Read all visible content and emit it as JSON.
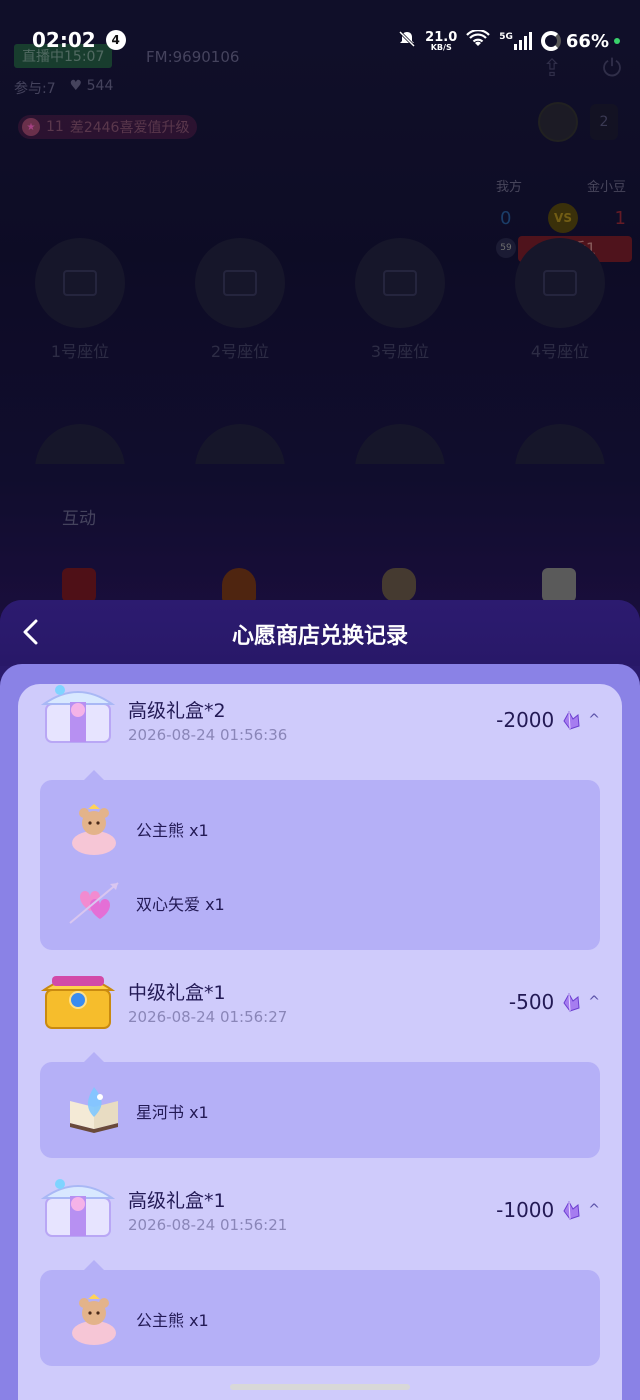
{
  "status_bar": {
    "time": "02:02",
    "notif_count": "4",
    "net_speed": "21.0",
    "net_unit": "KB/S",
    "network": "5G",
    "battery": "66%"
  },
  "room": {
    "live_status": "直播中15:07",
    "fm_id": "FM:9690106",
    "participants": "参与:7",
    "likes": "544",
    "level": "11",
    "level_hint": "差2446喜爱值升级",
    "online_count": "2",
    "pk": {
      "our_side": "我方",
      "their_side": "金小豆",
      "our_score": "0",
      "their_score": "1",
      "vs": "VS",
      "status": "落后1",
      "timer": "59"
    },
    "seats": [
      "1号座位",
      "2号座位",
      "3号座位",
      "4号座位"
    ],
    "interact_label": "互动"
  },
  "modal": {
    "title": "心愿商店兑换记录",
    "records": [
      {
        "title": "高级礼盒*2",
        "time": "2026-08-24 01:56:36",
        "cost": "-2000",
        "box": "silver",
        "items": [
          {
            "name": "公主熊 x1",
            "icon": "bear"
          },
          {
            "name": "双心矢爱 x1",
            "icon": "hearts"
          }
        ]
      },
      {
        "title": "中级礼盒*1",
        "time": "2026-08-24 01:56:27",
        "cost": "-500",
        "box": "gold",
        "items": [
          {
            "name": "星河书 x1",
            "icon": "book"
          }
        ]
      },
      {
        "title": "高级礼盒*1",
        "time": "2026-08-24 01:56:21",
        "cost": "-1000",
        "box": "silver",
        "items": [
          {
            "name": "公主熊 x1",
            "icon": "bear"
          }
        ]
      }
    ]
  },
  "colors": {
    "modal_header": "#2a1a6c",
    "modal_frame": "#8a82e6",
    "list_bg": "#cfcbfb",
    "detail_bg": "#b5b0f7",
    "text_dark": "#231a55"
  }
}
